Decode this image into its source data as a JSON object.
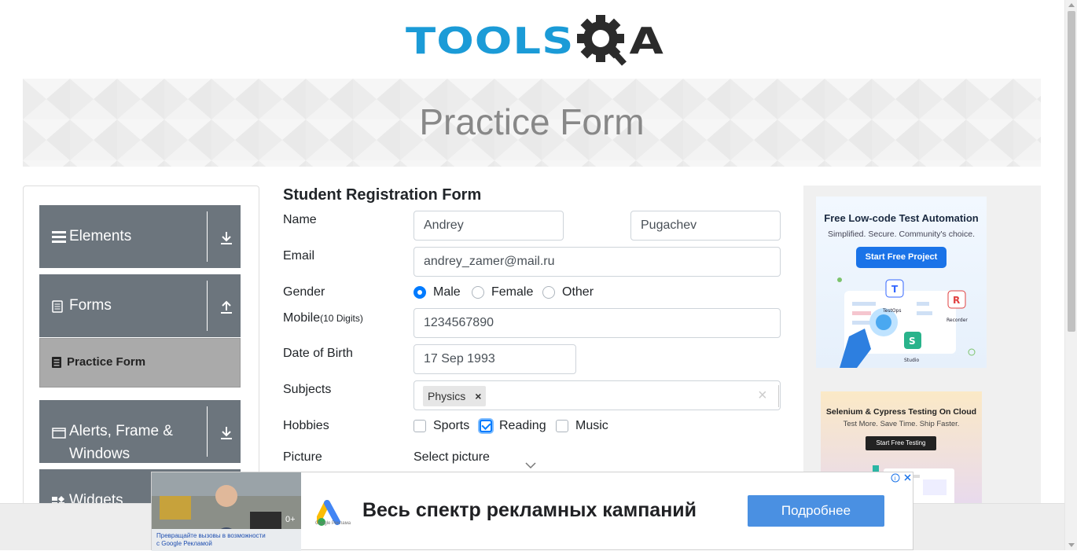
{
  "logo": {
    "text_left": "TOOLS",
    "text_right": "A"
  },
  "header": {
    "title": "Practice Form"
  },
  "sidebar": {
    "groups": [
      {
        "label": "Elements"
      },
      {
        "label": "Forms"
      },
      {
        "label_line1": "Alerts, Frame &",
        "label_line2": "Windows"
      },
      {
        "label": "Widgets"
      }
    ],
    "active_item": "Practice Form"
  },
  "form": {
    "heading": "Student Registration Form",
    "name_label": "Name",
    "first_name": "Andrey",
    "last_name": "Pugachev",
    "email_label": "Email",
    "email": "andrey_zamer@mail.ru",
    "gender_label": "Gender",
    "genders": [
      "Male",
      "Female",
      "Other"
    ],
    "gender_selected": "Male",
    "mobile_label": "Mobile",
    "mobile_hint": "(10 Digits)",
    "mobile": "1234567890",
    "dob_label": "Date of Birth",
    "dob": "17 Sep 1993",
    "subjects_label": "Subjects",
    "subject_tag": "Physics",
    "subject_tag_remove": "×",
    "subjects_clear": "×",
    "hobbies_label": "Hobbies",
    "hobbies": [
      "Sports",
      "Reading",
      "Music"
    ],
    "hobbies_checked": [
      "Reading"
    ],
    "picture_label": "Picture",
    "picture_button": "Select picture"
  },
  "ads": {
    "ad1": {
      "headline": "Free Low-code Test Automation",
      "sub": "Simplified. Secure. Community's choice.",
      "button": "Start Free Project",
      "labels": [
        "TestOps",
        "Recorder",
        "Studio"
      ]
    },
    "ad2": {
      "headline": "Selenium & Cypress Testing On Cloud",
      "sub": "Test More. Save Time. Ship Faster.",
      "button": "Start Free Testing"
    },
    "bottom": {
      "text": "Весь спектр рекламных кампаний",
      "button": "Подробнее",
      "caption": "Превращайте вызовы в возможности с Google Рекламой",
      "logo_caption": "Google Реклама",
      "photo_badge": "0+"
    }
  },
  "colors": {
    "brand_blue": "#1b9bd7",
    "accent": "#007bff",
    "sidebar_group": "#6c757d",
    "active_item": "#aaaaaa"
  }
}
